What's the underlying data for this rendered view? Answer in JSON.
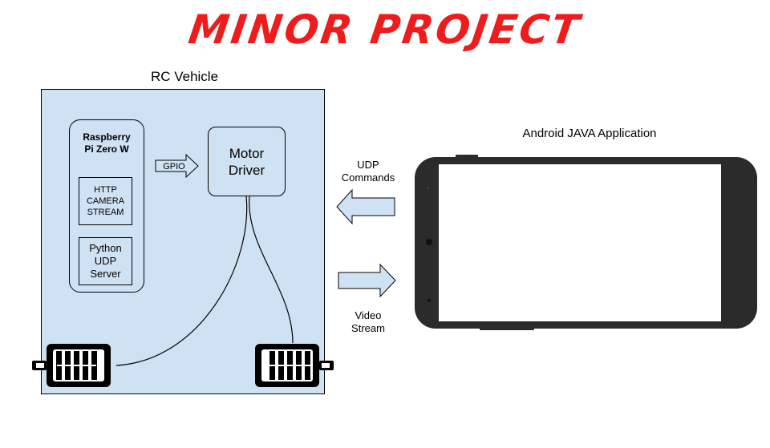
{
  "title": "MINOR PROJECT",
  "vehicle": {
    "label": "RC Vehicle",
    "pi": {
      "title_line1": "Raspberry",
      "title_line2": "Pi Zero W",
      "http_line1": "HTTP",
      "http_line2": "CAMERA",
      "http_line3": "STREAM",
      "udp_line1": "Python",
      "udp_line2": "UDP",
      "udp_line3": "Server"
    },
    "gpio": "GPIO",
    "motor_line1": "Motor",
    "motor_line2": "Driver"
  },
  "phone": {
    "label": "Android JAVA Application"
  },
  "arrows": {
    "udp_line1": "UDP",
    "udp_line2": "Commands",
    "video_line1": "Video",
    "video_line2": "Stream"
  },
  "colors": {
    "title": "#ee1c1c",
    "vehicle_fill": "#cfe2f3",
    "arrow_fill": "#cfe2f3",
    "phone_body": "#2b2b2b"
  }
}
